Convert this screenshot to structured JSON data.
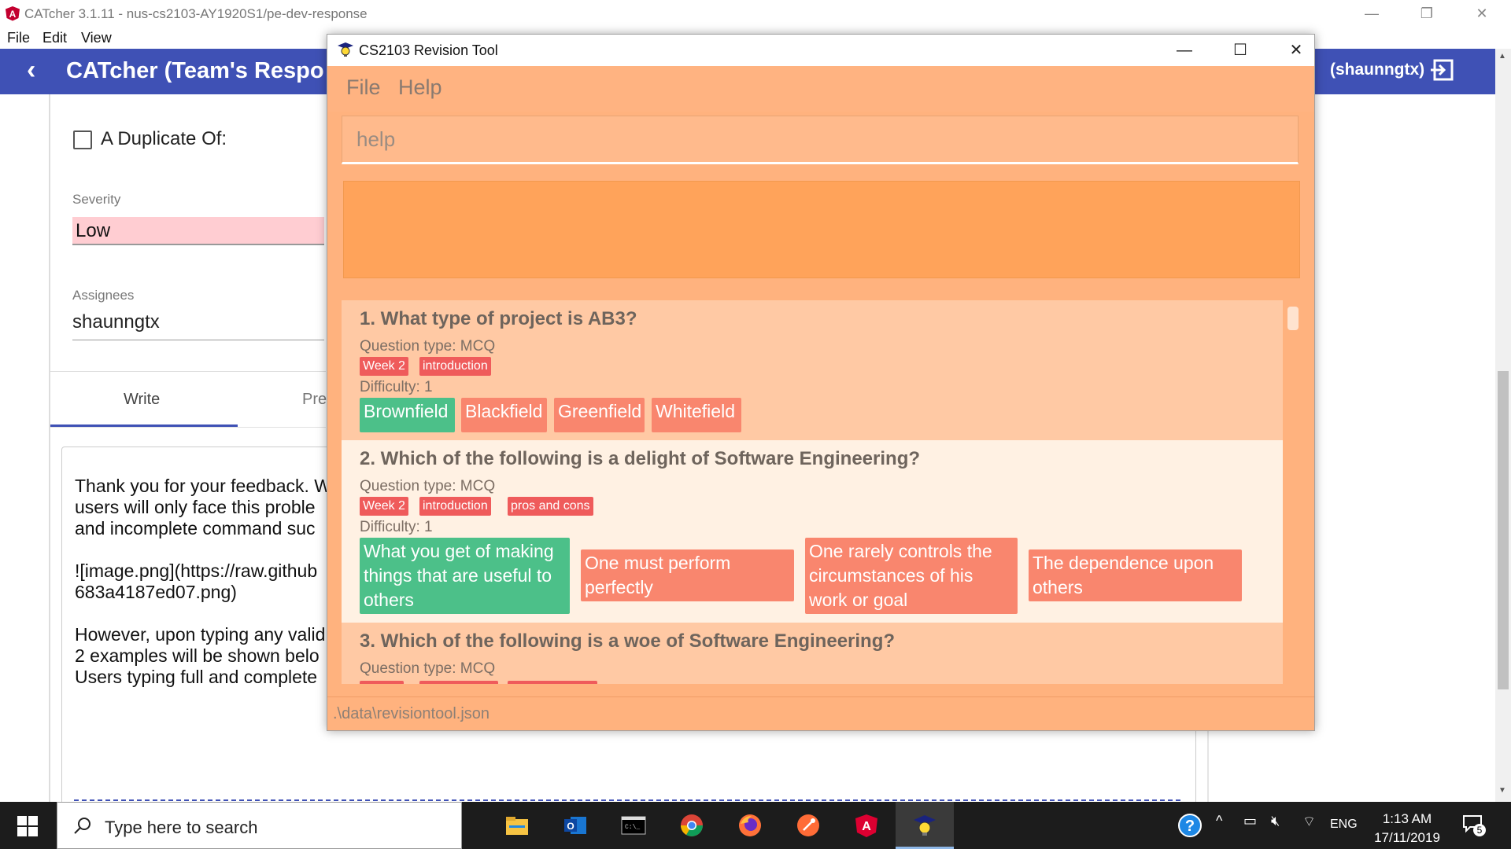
{
  "bg_window": {
    "title": "CATcher 3.1.11 - nus-cs2103-AY1920S1/pe-dev-response",
    "menu": [
      "File",
      "Edit",
      "View"
    ],
    "page_title": "CATcher (Team's Respo",
    "user": "(shaunngtx)",
    "duplicate_label": "A Duplicate Of:",
    "severity_label": "Severity",
    "severity_value": "Low",
    "assignees_label": "Assignees",
    "assignees_value": "shaunngtx",
    "tab_write": "Write",
    "tab_preview": "Pre",
    "editor_text": "Thank you for your feedback. W\nusers will only face this proble\nand incomplete command suc\n\n![image.png](https://raw.github\n683a4187ed07.png)\n\nHowever, upon typing any valid\n2 examples will be shown belo\nUsers typing full and complete"
  },
  "revision_tool": {
    "title": "CS2103 Revision Tool",
    "menu": [
      "File",
      "Help"
    ],
    "command_text": "help",
    "status_path": ".\\data\\revisiontool.json",
    "questions": [
      {
        "heading": "1.  What type of project is AB3?",
        "type_label": "Question type: MCQ",
        "tags": [
          "Week 2",
          "introduction"
        ],
        "difficulty_label": "Difficulty: 1",
        "options": [
          {
            "text": "Brownfield",
            "correct": true
          },
          {
            "text": "Blackfield",
            "correct": false
          },
          {
            "text": "Greenfield",
            "correct": false
          },
          {
            "text": "Whitefield",
            "correct": false
          }
        ]
      },
      {
        "heading": "2.  Which of the following is a delight of Software Engineering?",
        "type_label": "Question type: MCQ",
        "tags": [
          "Week 2",
          "introduction",
          "pros and cons"
        ],
        "difficulty_label": "Difficulty: 1",
        "options": [
          {
            "text": "What you get of making things that are useful to others",
            "correct": true
          },
          {
            "text": "One must perform perfectly",
            "correct": false
          },
          {
            "text": "One rarely controls the circumstances of his work or goal",
            "correct": false
          },
          {
            "text": "The dependence upon others",
            "correct": false
          }
        ]
      },
      {
        "heading": "3.  Which of the following is a woe of Software Engineering?",
        "type_label": "Question type: MCQ"
      }
    ]
  },
  "taskbar": {
    "search_placeholder": "Type here to search",
    "language": "ENG",
    "time": "1:13 AM",
    "date": "17/11/2019",
    "notification_count": "5"
  },
  "colors": {
    "catcher_header": "#3f51b5",
    "revision_bg": "#ffb27e",
    "tag_red": "#ef5b5b",
    "option_correct": "#4cc089",
    "option_wrong": "#f9866e",
    "card_light": "#fff1e3",
    "card_dark": "#ffc9a4"
  }
}
